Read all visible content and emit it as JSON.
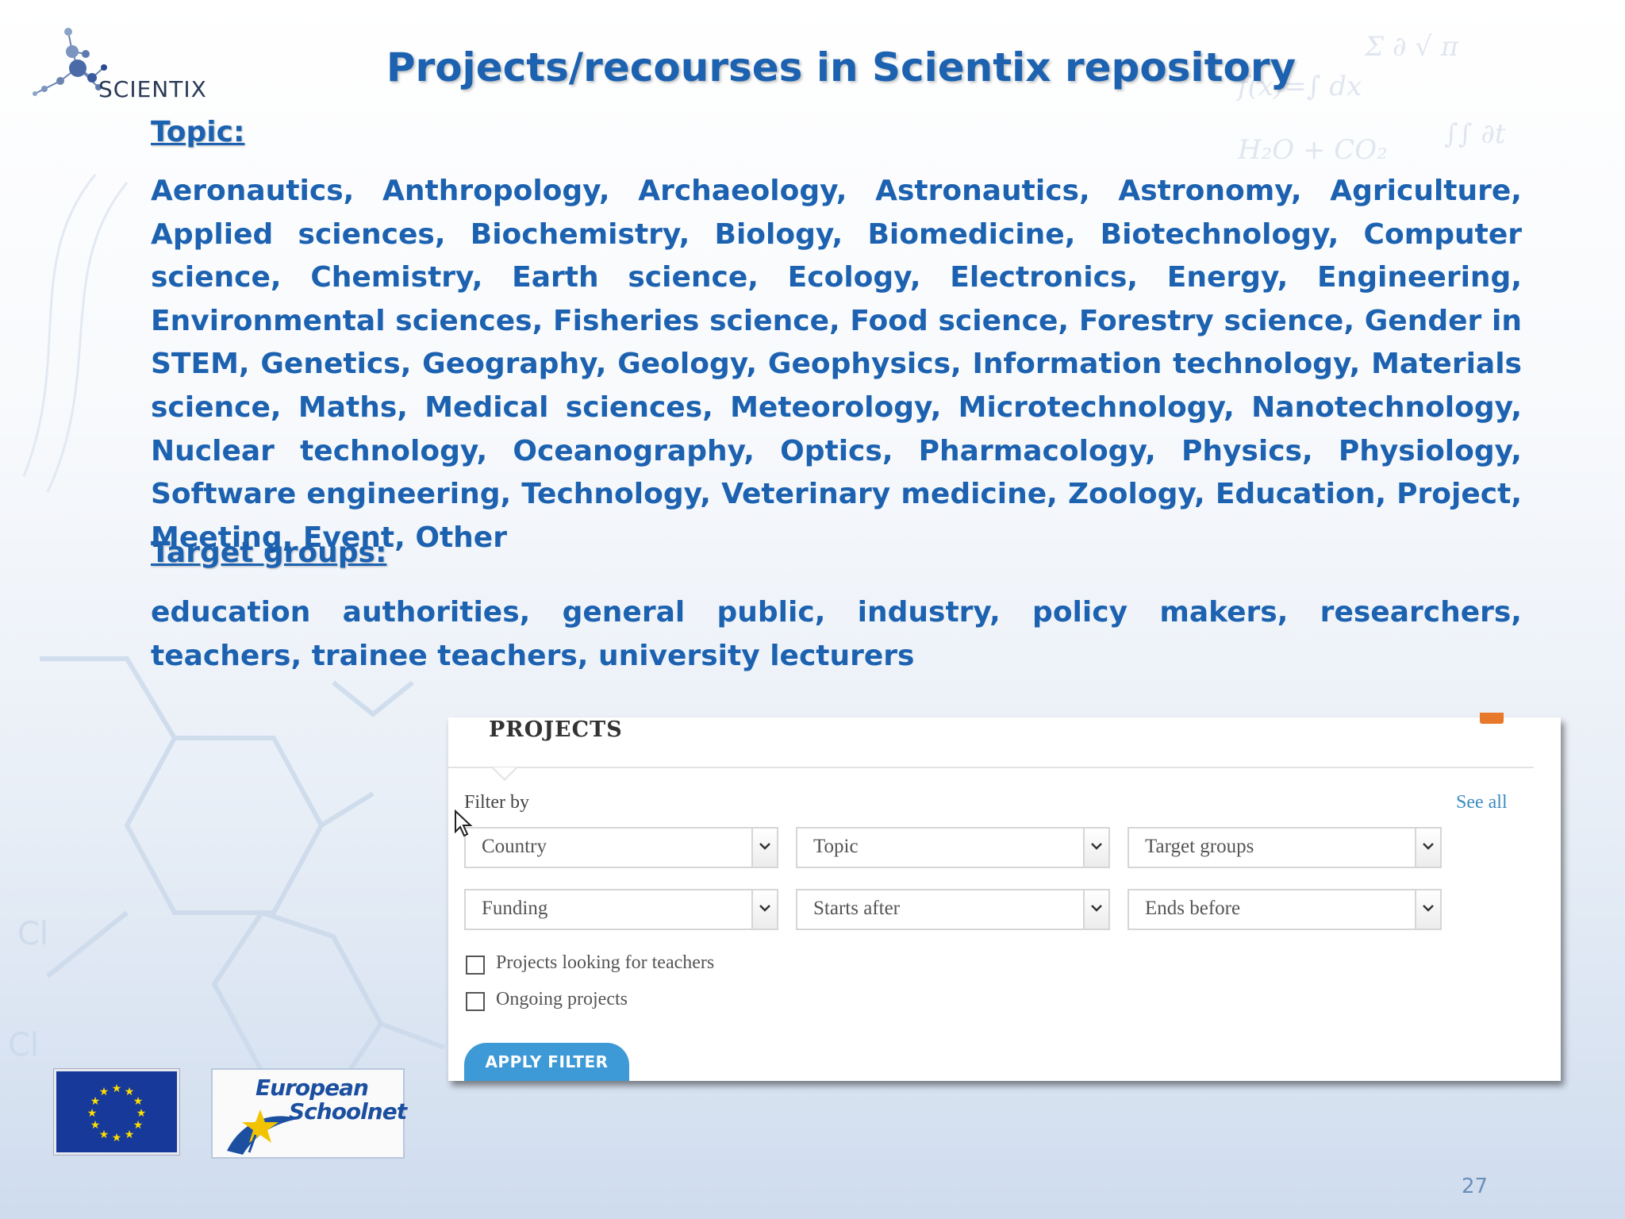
{
  "slide": {
    "title": "Projects/recourses in Scientix repository",
    "logo_text": "SCIENTIX",
    "page_number": "27",
    "topic_label": "Topic:",
    "topic_text": "Aeronautics, Anthropology, Archaeology, Astronautics, Astronomy, Agriculture, Applied sciences, Biochemistry, Biology, Biomedicine, Biotechnology, Computer science, Chemistry, Earth science, Ecology, Electronics, Energy, Engineering, Environmental sciences, Fisheries science, Food science, Forestry science, Gender in STEM, Genetics, Geography, Geology, Geophysics, Information technology, Materials science, Maths, Medical sciences, Meteorology, Microtechnology, Nanotechnology, Nuclear technology, Oceanography, Optics, Pharmacology, Physics, Physiology, Software engineering, Technology, Veterinary medicine, Zoology, Education, Project, Meeting, Event, Other",
    "target_label": "Target groups:",
    "target_text": "education authorities, general public, industry, policy makers, researchers, teachers, trainee teachers, university lecturers"
  },
  "projects_panel": {
    "title": "PROJECTS",
    "filter_by": "Filter by",
    "see_all": "See all",
    "selects": [
      {
        "label": "Country"
      },
      {
        "label": "Topic"
      },
      {
        "label": "Target groups"
      },
      {
        "label": "Funding"
      },
      {
        "label": "Starts after"
      },
      {
        "label": "Ends before"
      }
    ],
    "checkboxes": [
      {
        "label": "Projects looking for teachers",
        "checked": false
      },
      {
        "label": "Ongoing projects",
        "checked": false
      }
    ],
    "apply_label": "APPLY FILTER"
  },
  "footer": {
    "esn_line1": "European",
    "esn_line2": "Schoolnet"
  },
  "colors": {
    "title_blue": "#1c62b0",
    "link_blue": "#3d8cc2",
    "apply_button": "#3d9ad6",
    "eu_blue": "#16399a",
    "eu_star": "#ffdd00"
  },
  "icons": [
    "molecule-logo-icon",
    "chevron-down-icon",
    "rss-icon",
    "mouse-cursor-icon",
    "eu-flag-icon",
    "star-icon"
  ]
}
